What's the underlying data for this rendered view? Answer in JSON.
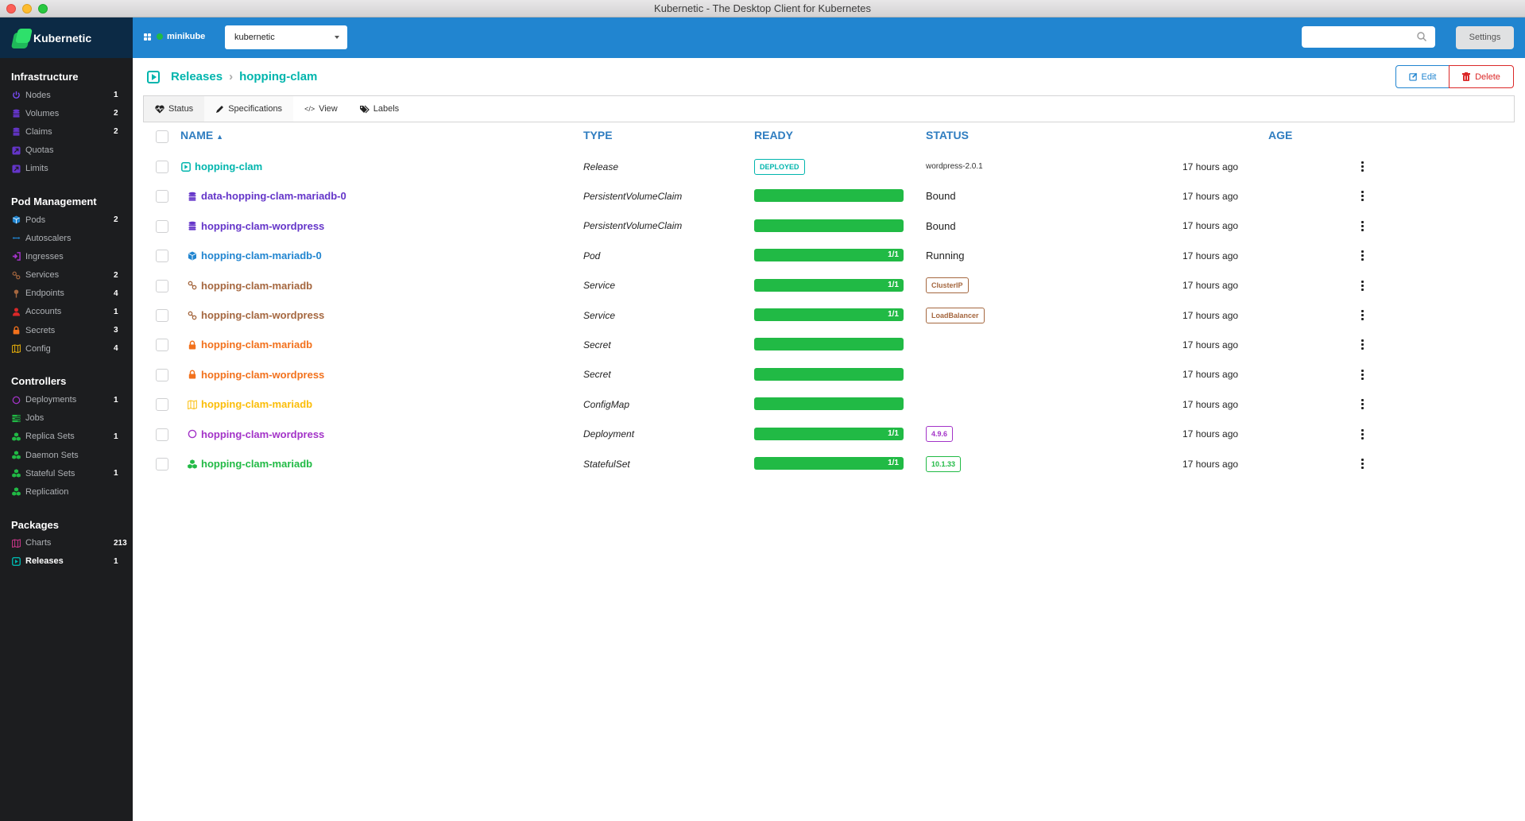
{
  "window": {
    "title": "Kubernetic - The Desktop Client for Kubernetes"
  },
  "brand": {
    "name": "Kubernetic"
  },
  "header": {
    "cluster": "minikube",
    "namespace": "kubernetic",
    "search_placeholder": "",
    "settings_label": "Settings"
  },
  "sidebar": {
    "sections": [
      {
        "title": "Infrastructure",
        "items": [
          {
            "label": "Nodes",
            "count": "1",
            "icon": "power-icon",
            "color": "#7c4dff"
          },
          {
            "label": "Volumes",
            "count": "2",
            "icon": "database-icon",
            "color": "#6435c9"
          },
          {
            "label": "Claims",
            "count": "2",
            "icon": "database-icon",
            "color": "#6435c9"
          },
          {
            "label": "Quotas",
            "count": "",
            "icon": "external-square-icon",
            "color": "#6435c9"
          },
          {
            "label": "Limits",
            "count": "",
            "icon": "external-square-icon",
            "color": "#6435c9"
          }
        ]
      },
      {
        "title": "Pod Management",
        "items": [
          {
            "label": "Pods",
            "count": "2",
            "icon": "cube-icon",
            "color": "#2185d0"
          },
          {
            "label": "Autoscalers",
            "count": "",
            "icon": "arrows-horizontal-icon",
            "color": "#2185d0"
          },
          {
            "label": "Ingresses",
            "count": "",
            "icon": "sign-in-icon",
            "color": "#a333c8"
          },
          {
            "label": "Services",
            "count": "2",
            "icon": "linkify-icon",
            "color": "#a5673f"
          },
          {
            "label": "Endpoints",
            "count": "4",
            "icon": "pin-icon",
            "color": "#a5673f"
          },
          {
            "label": "Accounts",
            "count": "1",
            "icon": "user-icon",
            "color": "#db2828"
          },
          {
            "label": "Secrets",
            "count": "3",
            "icon": "lock-icon",
            "color": "#f2711c"
          },
          {
            "label": "Config",
            "count": "4",
            "icon": "map-icon",
            "color": "#fbbd08"
          }
        ]
      },
      {
        "title": "Controllers",
        "items": [
          {
            "label": "Deployments",
            "count": "1",
            "icon": "circle-notch-icon",
            "color": "#a333c8"
          },
          {
            "label": "Jobs",
            "count": "",
            "icon": "tasks-icon",
            "color": "#21ba45"
          },
          {
            "label": "Replica Sets",
            "count": "1",
            "icon": "cubes-icon",
            "color": "#21ba45"
          },
          {
            "label": "Daemon Sets",
            "count": "",
            "icon": "cubes-icon",
            "color": "#21ba45"
          },
          {
            "label": "Stateful Sets",
            "count": "1",
            "icon": "cubes-icon",
            "color": "#21ba45"
          },
          {
            "label": "Replication",
            "count": "",
            "icon": "cubes-icon",
            "color": "#21ba45"
          }
        ]
      },
      {
        "title": "Packages",
        "items": [
          {
            "label": "Charts",
            "count": "213",
            "icon": "map-icon",
            "color": "#e03997"
          },
          {
            "label": "Releases",
            "count": "1",
            "icon": "play-square-icon",
            "color": "#00b5ad",
            "active": true
          }
        ]
      }
    ]
  },
  "breadcrumb": {
    "parent": "Releases",
    "current": "hopping-clam"
  },
  "actions": {
    "edit_label": "Edit",
    "delete_label": "Delete"
  },
  "tabs": [
    {
      "label": "Status",
      "icon": "heartbeat-icon",
      "active": true
    },
    {
      "label": "Specifications",
      "icon": "pencil-icon"
    },
    {
      "label": "View",
      "icon": "code-icon"
    },
    {
      "label": "Labels",
      "icon": "tags-icon"
    }
  ],
  "table": {
    "columns": {
      "name": "NAME",
      "type": "TYPE",
      "ready": "READY",
      "status": "STATUS",
      "age": "AGE"
    },
    "sort": {
      "column": "NAME",
      "direction": "ascending"
    },
    "rows": [
      {
        "name": "hopping-clam",
        "icon": "play-square-icon",
        "color": "#00b5ad",
        "type": "Release",
        "ready_badge": "DEPLOYED",
        "ready": null,
        "ready_label": "",
        "status": "wordpress-2.0.1",
        "status_style": "small",
        "status_badge_color": "",
        "age": "17 hours ago"
      },
      {
        "name": "data-hopping-clam-mariadb-0",
        "icon": "database-icon",
        "color": "#6435c9",
        "type": "PersistentVolumeClaim",
        "ready": 1,
        "ready_label": "",
        "status": "Bound",
        "status_style": "big",
        "age": "17 hours ago"
      },
      {
        "name": "hopping-clam-wordpress",
        "icon": "database-icon",
        "color": "#6435c9",
        "type": "PersistentVolumeClaim",
        "ready": 1,
        "ready_label": "",
        "status": "Bound",
        "status_style": "big",
        "age": "17 hours ago"
      },
      {
        "name": "hopping-clam-mariadb-0",
        "icon": "cube-icon",
        "color": "#2185d0",
        "type": "Pod",
        "ready": 1,
        "ready_label": "1/1",
        "status": "Running",
        "status_style": "big",
        "age": "17 hours ago"
      },
      {
        "name": "hopping-clam-mariadb",
        "icon": "linkify-icon",
        "color": "#a5673f",
        "type": "Service",
        "ready": 1,
        "ready_label": "1/1",
        "status": "ClusterIP",
        "status_style": "badge",
        "status_badge_color": "#a5673f",
        "age": "17 hours ago"
      },
      {
        "name": "hopping-clam-wordpress",
        "icon": "linkify-icon",
        "color": "#a5673f",
        "type": "Service",
        "ready": 1,
        "ready_label": "1/1",
        "status": "LoadBalancer",
        "status_style": "badge",
        "status_badge_color": "#a5673f",
        "age": "17 hours ago"
      },
      {
        "name": "hopping-clam-mariadb",
        "icon": "lock-icon",
        "color": "#f2711c",
        "type": "Secret",
        "ready": 1,
        "ready_label": "",
        "status": "",
        "status_style": "none",
        "age": "17 hours ago"
      },
      {
        "name": "hopping-clam-wordpress",
        "icon": "lock-icon",
        "color": "#f2711c",
        "type": "Secret",
        "ready": 1,
        "ready_label": "",
        "status": "",
        "status_style": "none",
        "age": "17 hours ago"
      },
      {
        "name": "hopping-clam-mariadb",
        "icon": "map-icon",
        "color": "#fbbd08",
        "type": "ConfigMap",
        "ready": 1,
        "ready_label": "",
        "status": "",
        "status_style": "none",
        "age": "17 hours ago"
      },
      {
        "name": "hopping-clam-wordpress",
        "icon": "circle-notch-icon",
        "color": "#a333c8",
        "type": "Deployment",
        "ready": 1,
        "ready_label": "1/1",
        "status": "4.9.6",
        "status_style": "badge",
        "status_badge_color": "#a333c8",
        "age": "17 hours ago"
      },
      {
        "name": "hopping-clam-mariadb",
        "icon": "cubes-icon",
        "color": "#21ba45",
        "type": "StatefulSet",
        "ready": 1,
        "ready_label": "1/1",
        "status": "10.1.33",
        "status_style": "badge",
        "status_badge_color": "#21ba45",
        "age": "17 hours ago"
      }
    ]
  },
  "colors": {
    "header_blue": "#2185d0",
    "sidebar_bg": "#1c1d1f",
    "logo_bg": "#0c2a45",
    "ready_green": "#21ba45",
    "release_teal": "#00b5ad",
    "delete_red": "#db2828"
  }
}
